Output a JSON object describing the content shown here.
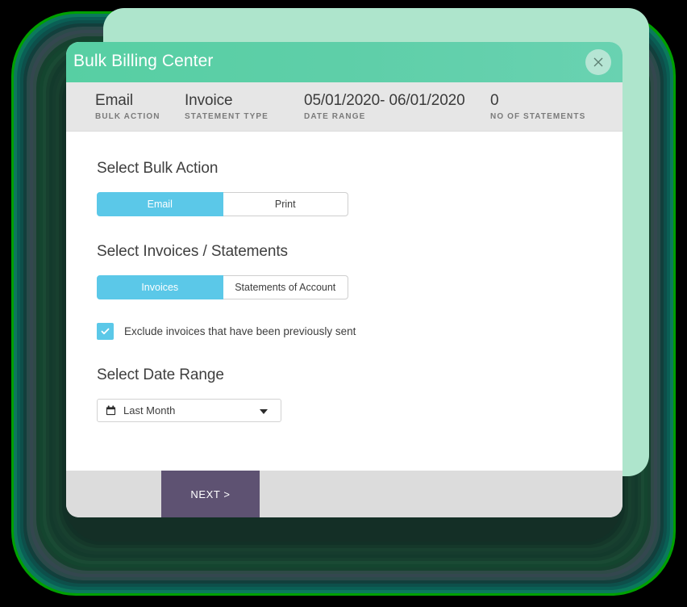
{
  "window": {
    "title": "Bulk Billing Center",
    "close_icon": "close-icon"
  },
  "summary": {
    "items": [
      {
        "value": "Email",
        "label": "BULK ACTION"
      },
      {
        "value": "Invoice",
        "label": "STATEMENT TYPE"
      },
      {
        "value": "05/01/2020- 06/01/2020",
        "label": "DATE RANGE"
      },
      {
        "value": "0",
        "label": "NO OF STATEMENTS"
      }
    ]
  },
  "bulk_action": {
    "title": "Select Bulk Action",
    "options": [
      {
        "label": "Email",
        "selected": true
      },
      {
        "label": "Print",
        "selected": false
      }
    ]
  },
  "statements": {
    "title": "Select Invoices / Statements",
    "options": [
      {
        "label": "Invoices",
        "selected": true
      },
      {
        "label": "Statements of Account",
        "selected": false
      }
    ],
    "exclude_checkbox": {
      "label": "Exclude invoices that have been previously sent",
      "checked": true,
      "icon": "check-icon"
    }
  },
  "date_range": {
    "title": "Select Date Range",
    "selected": "Last Month",
    "calendar_icon": "calendar-icon",
    "caret_icon": "chevron-down-icon"
  },
  "footer": {
    "next_label": "NEXT >"
  },
  "colors": {
    "header_teal": "#5fcfa9",
    "accent_blue": "#5bc8e8",
    "next_purple": "#5e5272",
    "mint_panel": "#aee5cc",
    "summary_bg": "#e6e6e6",
    "footer_bg": "#dcdcdc"
  },
  "decor": {
    "rings": [
      {
        "inset": 14,
        "color": "#00a000"
      },
      {
        "inset": 17,
        "color": "#0b7a5c"
      },
      {
        "inset": 21,
        "color": "#0a5f55"
      },
      {
        "inset": 25,
        "color": "#0d4f4a"
      },
      {
        "inset": 29,
        "color": "#123f3c"
      },
      {
        "inset": 33,
        "color": "#2b4a4a"
      },
      {
        "inset": 37,
        "color": "#34474f"
      },
      {
        "inset": 41,
        "color": "#2f4a47"
      },
      {
        "inset": 45,
        "color": "#16412f"
      },
      {
        "inset": 49,
        "color": "#14452f"
      },
      {
        "inset": 53,
        "color": "#1a4a34"
      },
      {
        "inset": 57,
        "color": "#17402f"
      },
      {
        "inset": 61,
        "color": "#133a2c"
      },
      {
        "inset": 65,
        "color": "#163c2e"
      },
      {
        "inset": 69,
        "color": "#18402f"
      },
      {
        "inset": 73,
        "color": "#15382a"
      },
      {
        "inset": 77,
        "color": "#123127"
      },
      {
        "inset": 81,
        "color": "#142f26"
      }
    ]
  }
}
